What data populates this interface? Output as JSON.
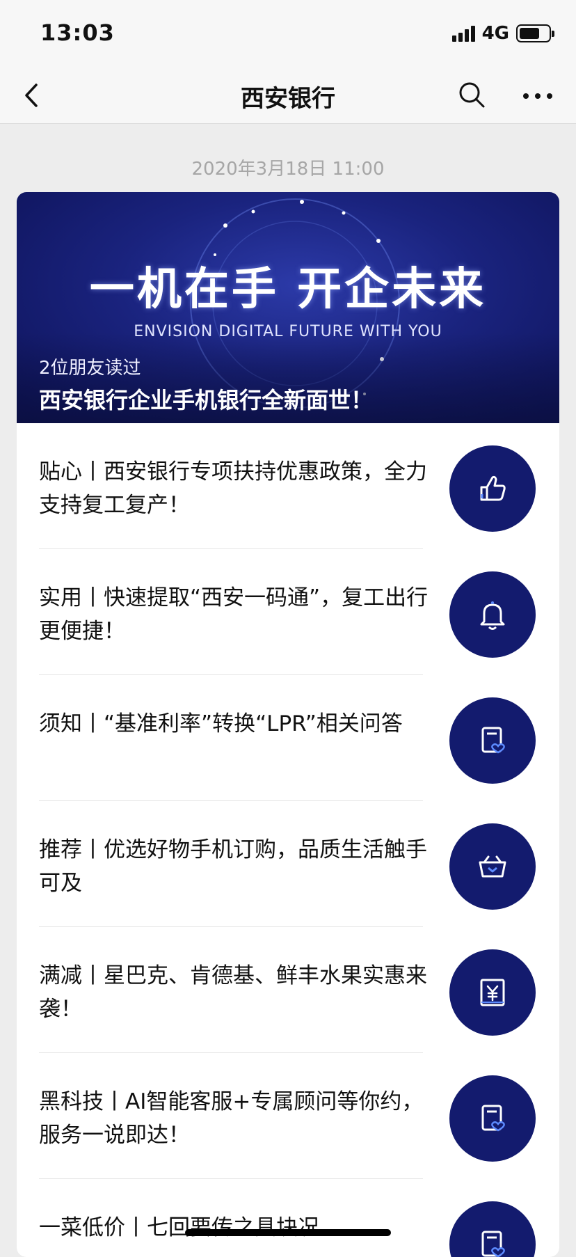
{
  "status_bar": {
    "time": "13:03",
    "network": "4G"
  },
  "nav": {
    "title": "西安银行"
  },
  "timestamp": "2020年3月18日 11:00",
  "hero": {
    "slogan": "一机在手 开企未来",
    "subtitle": "ENVISION DIGITAL FUTURE WITH YOU",
    "readers": "2位朋友读过",
    "title": "西安银行企业手机银行全新面世！"
  },
  "articles": [
    {
      "text": "贴心丨西安银行专项扶持优惠政策，全力支持复工复产！",
      "icon": "thumbs-up-icon"
    },
    {
      "text": "实用丨快速提取“西安一码通”，复工出行更便捷！",
      "icon": "bell-icon"
    },
    {
      "text": "须知丨“基准利率”转换“LPR”相关问答",
      "icon": "document-heart-icon"
    },
    {
      "text": "推荐丨优选好物手机订购，品质生活触手可及",
      "icon": "basket-icon"
    },
    {
      "text": "满减丨星巴克、肯德基、鲜丰水果实惠来袭！",
      "icon": "yuan-voucher-icon"
    },
    {
      "text": "黑科技丨AI智能客服+专属顾问等你约，服务一说即达！",
      "icon": "document-heart-icon"
    },
    {
      "text": "一菜低价丨七回要传之具块况",
      "icon": "document-heart-icon"
    }
  ],
  "colors": {
    "brand_navy": "#131b6e",
    "background": "#ededed"
  }
}
